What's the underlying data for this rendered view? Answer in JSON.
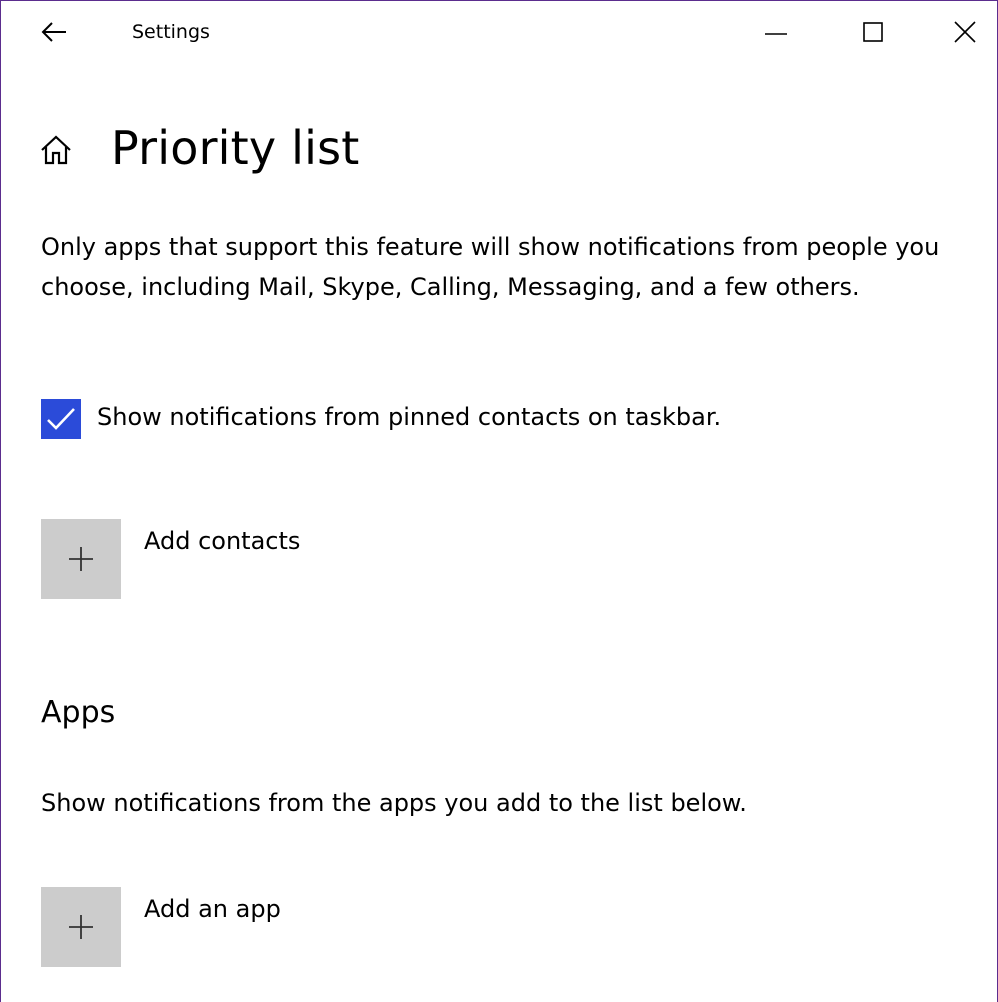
{
  "window": {
    "title": "Settings",
    "border_color": "#5b2d8e"
  },
  "icons": {
    "back": "back-arrow-icon",
    "minimize": "minimize-icon",
    "maximize": "maximize-icon",
    "close": "close-icon",
    "home": "home-icon",
    "checkmark": "checkmark-icon",
    "plus": "plus-icon"
  },
  "page": {
    "title": "Priority list",
    "description": "Only apps that support this feature will show notifications from people you choose, including Mail, Skype, Calling, Messaging, and a few others."
  },
  "pinned_contacts": {
    "checked": true,
    "label": "Show notifications from pinned contacts on taskbar.",
    "accent_color": "#2b4bd9"
  },
  "contacts": {
    "add_label": "Add contacts"
  },
  "apps": {
    "section_title": "Apps",
    "description": "Show notifications from the apps you add to the list below.",
    "add_label": "Add an app"
  },
  "tile_color": "#cccccc"
}
